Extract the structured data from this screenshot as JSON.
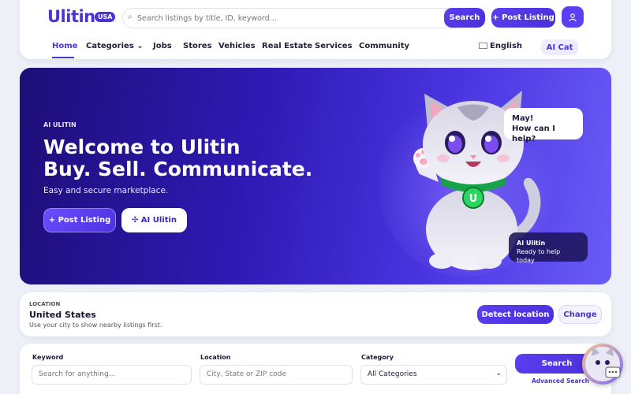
{
  "header": {
    "logo": "Ulitin",
    "badge": "USA",
    "search_placeholder": "Search listings by title, ID, keyword...",
    "search_button": "Search",
    "post_button": "+ Post Listing",
    "nav": [
      "Home",
      "Categories ⌄",
      "Jobs",
      "Stores",
      "Vehicles",
      "Real Estate",
      "Services",
      "Community"
    ],
    "language": "English",
    "ai_button": "AI Cat"
  },
  "hero": {
    "eyebrow": "AI ULITIN",
    "title_line1": "Welcome to Ulitin",
    "title_line2": "Buy. Sell. Communicate.",
    "lead": "Easy and secure marketplace.",
    "post_button": "+ Post Listing",
    "ai_button": "✣ AI Ulitin",
    "bubble_line1": "May!",
    "bubble_line2": "How can I help?",
    "tip_title": "AI Ulitin",
    "tip_text": "Ready to help today"
  },
  "location": {
    "label": "LOCATION",
    "value": "United States",
    "hint": "Use your city to show nearby listings first.",
    "detect_button": "Detect location",
    "change_button": "Change"
  },
  "search_form": {
    "keyword_label": "Keyword",
    "keyword_placeholder": "Search for anything...",
    "location_label": "Location",
    "location_placeholder": "City, State or ZIP code",
    "category_label": "Category",
    "category_value": "All Categories",
    "search_button": "Search",
    "advanced_link": "Advanced Search"
  }
}
